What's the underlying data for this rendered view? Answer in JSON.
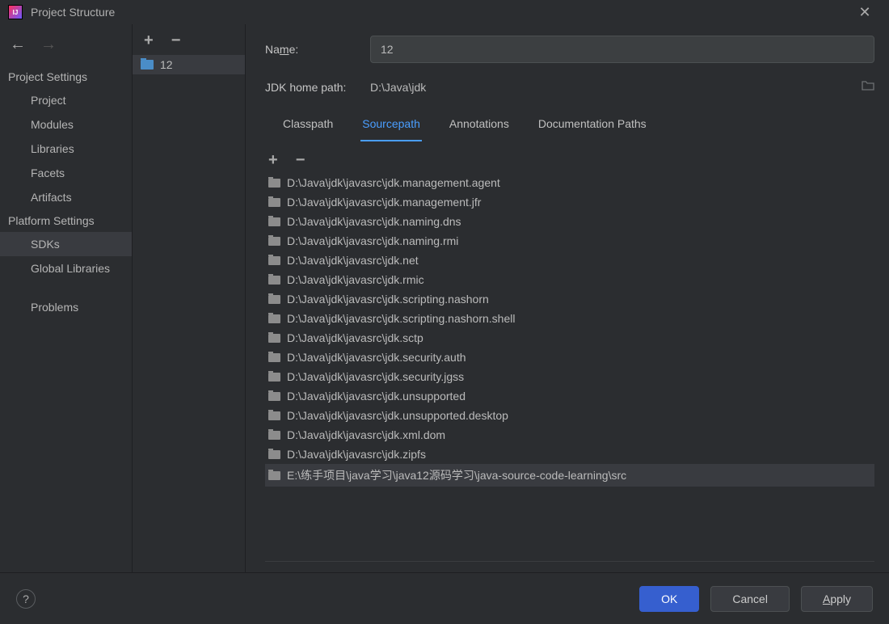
{
  "window": {
    "title": "Project Structure"
  },
  "nav": {
    "projectSettingsHeader": "Project Settings",
    "projectSettings": [
      {
        "label": "Project"
      },
      {
        "label": "Modules"
      },
      {
        "label": "Libraries"
      },
      {
        "label": "Facets"
      },
      {
        "label": "Artifacts"
      }
    ],
    "platformSettingsHeader": "Platform Settings",
    "platformSettings": [
      {
        "label": "SDKs",
        "selected": true
      },
      {
        "label": "Global Libraries"
      }
    ],
    "problems": "Problems"
  },
  "sdkList": {
    "items": [
      {
        "label": "12",
        "selected": true
      }
    ]
  },
  "details": {
    "nameLabel": "Name:",
    "nameMnemonicChar": "m",
    "nameValue": "12",
    "jdkHomePathLabel": "JDK home path:",
    "jdkHomePathValue": "D:\\Java\\jdk",
    "tabs": [
      {
        "label": "Classpath"
      },
      {
        "label": "Sourcepath",
        "active": true
      },
      {
        "label": "Annotations"
      },
      {
        "label": "Documentation Paths"
      }
    ],
    "sourcepaths": [
      "D:\\Java\\jdk\\javasrc\\jdk.management.agent",
      "D:\\Java\\jdk\\javasrc\\jdk.management.jfr",
      "D:\\Java\\jdk\\javasrc\\jdk.naming.dns",
      "D:\\Java\\jdk\\javasrc\\jdk.naming.rmi",
      "D:\\Java\\jdk\\javasrc\\jdk.net",
      "D:\\Java\\jdk\\javasrc\\jdk.rmic",
      "D:\\Java\\jdk\\javasrc\\jdk.scripting.nashorn",
      "D:\\Java\\jdk\\javasrc\\jdk.scripting.nashorn.shell",
      "D:\\Java\\jdk\\javasrc\\jdk.sctp",
      "D:\\Java\\jdk\\javasrc\\jdk.security.auth",
      "D:\\Java\\jdk\\javasrc\\jdk.security.jgss",
      "D:\\Java\\jdk\\javasrc\\jdk.unsupported",
      "D:\\Java\\jdk\\javasrc\\jdk.unsupported.desktop",
      "D:\\Java\\jdk\\javasrc\\jdk.xml.dom",
      "D:\\Java\\jdk\\javasrc\\jdk.zipfs",
      "E:\\练手项目\\java学习\\java12源码学习\\java-source-code-learning\\src"
    ],
    "selectedSourcepathIndex": 15
  },
  "footer": {
    "ok": "OK",
    "cancel": "Cancel",
    "apply": "Apply",
    "applyMnemonicChar": "A"
  }
}
